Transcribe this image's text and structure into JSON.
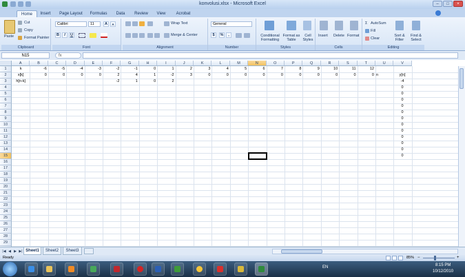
{
  "app": {
    "window_title": "konvolusi.xlsx - Microsoft Excel",
    "tabs": [
      "Home",
      "Insert",
      "Page Layout",
      "Formulas",
      "Data",
      "Review",
      "View",
      "Acrobat"
    ],
    "active_tab": "Home"
  },
  "ribbon": {
    "clipboard": {
      "paste": "Paste",
      "cut": "Cut",
      "copy": "Copy",
      "format_painter": "Format Painter",
      "label": "Clipboard"
    },
    "font": {
      "family": "Calibri",
      "size": "11",
      "bold": "B",
      "italic": "I",
      "underline": "U",
      "grow": "A",
      "shrink": "A",
      "label": "Font"
    },
    "alignment": {
      "wrap_text": "Wrap Text",
      "merge_center": "Merge & Center",
      "label": "Alignment"
    },
    "number": {
      "format": "General",
      "currency": "$",
      "percent": "%",
      "comma": ",",
      "label": "Number"
    },
    "styles": {
      "conditional": "Conditional Formatting",
      "format_table": "Format as Table",
      "cell_styles": "Cell Styles",
      "label": "Styles"
    },
    "cells": {
      "insert": "Insert",
      "delete": "Delete",
      "format": "Format",
      "label": "Cells"
    },
    "editing": {
      "autosum": "AutoSum",
      "fill": "Fill",
      "clear": "Clear",
      "sort_filter": "Sort & Filter",
      "find_select": "Find & Select",
      "label": "Editing"
    }
  },
  "formula_bar": {
    "name_box": "N15",
    "fx": "fx",
    "content": ""
  },
  "columns": [
    "A",
    "B",
    "C",
    "D",
    "E",
    "F",
    "G",
    "H",
    "I",
    "J",
    "K",
    "L",
    "M",
    "N",
    "O",
    "P",
    "Q",
    "R",
    "S",
    "T",
    "U",
    "V"
  ],
  "selected_col": "N",
  "selected_row": 15,
  "rows": 30,
  "cells": {
    "row1": {
      "A": "k",
      "B": "-6",
      "C": "-5",
      "D": "-4",
      "E": "-3",
      "F": "-2",
      "G": "-1",
      "H": "0",
      "I": "1",
      "J": "2",
      "K": "3",
      "L": "4",
      "M": "5",
      "N": "6",
      "O": "7",
      "P": "8",
      "Q": "9",
      "R": "10",
      "S": "11",
      "T": "12"
    },
    "row2": {
      "A": "x[k]",
      "B": "0",
      "C": "0",
      "D": "0",
      "E": "0",
      "F": "2",
      "G": "4",
      "H": "1",
      "I": "-2",
      "J": "3",
      "K": "0",
      "L": "0",
      "M": "0",
      "N": "0",
      "O": "0",
      "P": "0",
      "Q": "0",
      "R": "0",
      "S": "0",
      "T": "0",
      "U": "n",
      "V": "y[n]"
    },
    "row3": {
      "A": "h[n-k]",
      "F": "-2",
      "G": "1",
      "H": "0",
      "I": "2",
      "V": "-4"
    },
    "colV": [
      "0",
      "0",
      "0",
      "0",
      "0",
      "0",
      "0",
      "0",
      "0",
      "0",
      "0",
      "0"
    ]
  },
  "sheets": [
    "Sheet1",
    "Sheet2",
    "Sheet3"
  ],
  "active_sheet": "Sheet1",
  "status": {
    "ready": "Ready",
    "zoom": "85%"
  },
  "taskbar": {
    "language": "EN",
    "time": "8:15 PM",
    "date": "10/12/2010"
  }
}
